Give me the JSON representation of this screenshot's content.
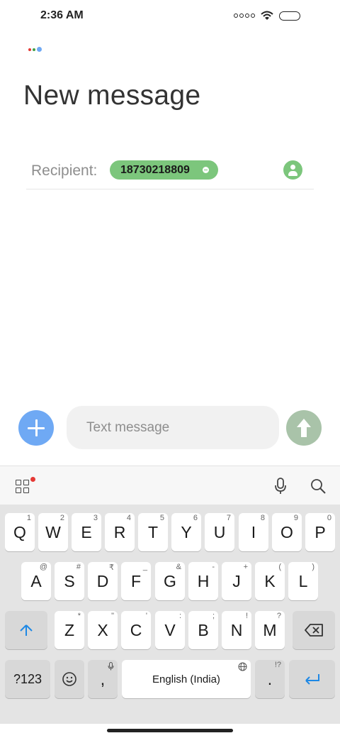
{
  "status_bar": {
    "time": "2:36 AM",
    "icons": [
      "signal-icon",
      "wifi-icon",
      "battery-icon"
    ]
  },
  "assistant": {
    "icon": "assistant-dots-icon",
    "colors": [
      "#e53935",
      "#43a047",
      "#6fa9f4"
    ]
  },
  "header": {
    "title": "New message"
  },
  "recipient": {
    "label": "Recipient:",
    "chips": [
      {
        "number": "18730218809",
        "remove_icon": "minus-circle-icon"
      }
    ],
    "contact_icon": "person-icon"
  },
  "compose": {
    "add_icon": "plus-icon",
    "placeholder": "Text message",
    "value": "",
    "send_icon": "arrow-up-icon",
    "colors": {
      "add": "#6fa9f4",
      "send": "#a9c3a9",
      "chip": "#7cc67c"
    }
  },
  "keyboard_toolbar": {
    "icons": [
      "apps-grid-icon",
      "microphone-icon",
      "search-icon"
    ],
    "notification_color": "#e53935"
  },
  "keyboard": {
    "row1": [
      {
        "label": "Q",
        "hint": "1"
      },
      {
        "label": "W",
        "hint": "2"
      },
      {
        "label": "E",
        "hint": "3"
      },
      {
        "label": "R",
        "hint": "4"
      },
      {
        "label": "T",
        "hint": "5"
      },
      {
        "label": "Y",
        "hint": "6"
      },
      {
        "label": "U",
        "hint": "7"
      },
      {
        "label": "I",
        "hint": "8"
      },
      {
        "label": "O",
        "hint": "9"
      },
      {
        "label": "P",
        "hint": "0"
      }
    ],
    "row2": [
      {
        "label": "A",
        "hint": "@"
      },
      {
        "label": "S",
        "hint": "#"
      },
      {
        "label": "D",
        "hint": "₹"
      },
      {
        "label": "F",
        "hint": "_"
      },
      {
        "label": "G",
        "hint": "&"
      },
      {
        "label": "H",
        "hint": "-"
      },
      {
        "label": "J",
        "hint": "+"
      },
      {
        "label": "K",
        "hint": "("
      },
      {
        "label": "L",
        "hint": ")"
      }
    ],
    "row3": [
      {
        "label": "Z",
        "hint": "*"
      },
      {
        "label": "X",
        "hint": "\""
      },
      {
        "label": "C",
        "hint": "'"
      },
      {
        "label": "V",
        "hint": ":"
      },
      {
        "label": "B",
        "hint": ";"
      },
      {
        "label": "N",
        "hint": "!"
      },
      {
        "label": "M",
        "hint": "?"
      }
    ],
    "shift_icon": "shift-arrow-icon",
    "backspace_icon": "backspace-icon",
    "num_sym": "?123",
    "emoji_icon": "emoji-icon",
    "comma": ",",
    "space": "English (India)",
    "space_icon": "globe-icon",
    "period": ".",
    "period_hint": "!?",
    "enter_icon": "enter-icon"
  },
  "nav": {
    "home_indicator": "home-pill"
  }
}
